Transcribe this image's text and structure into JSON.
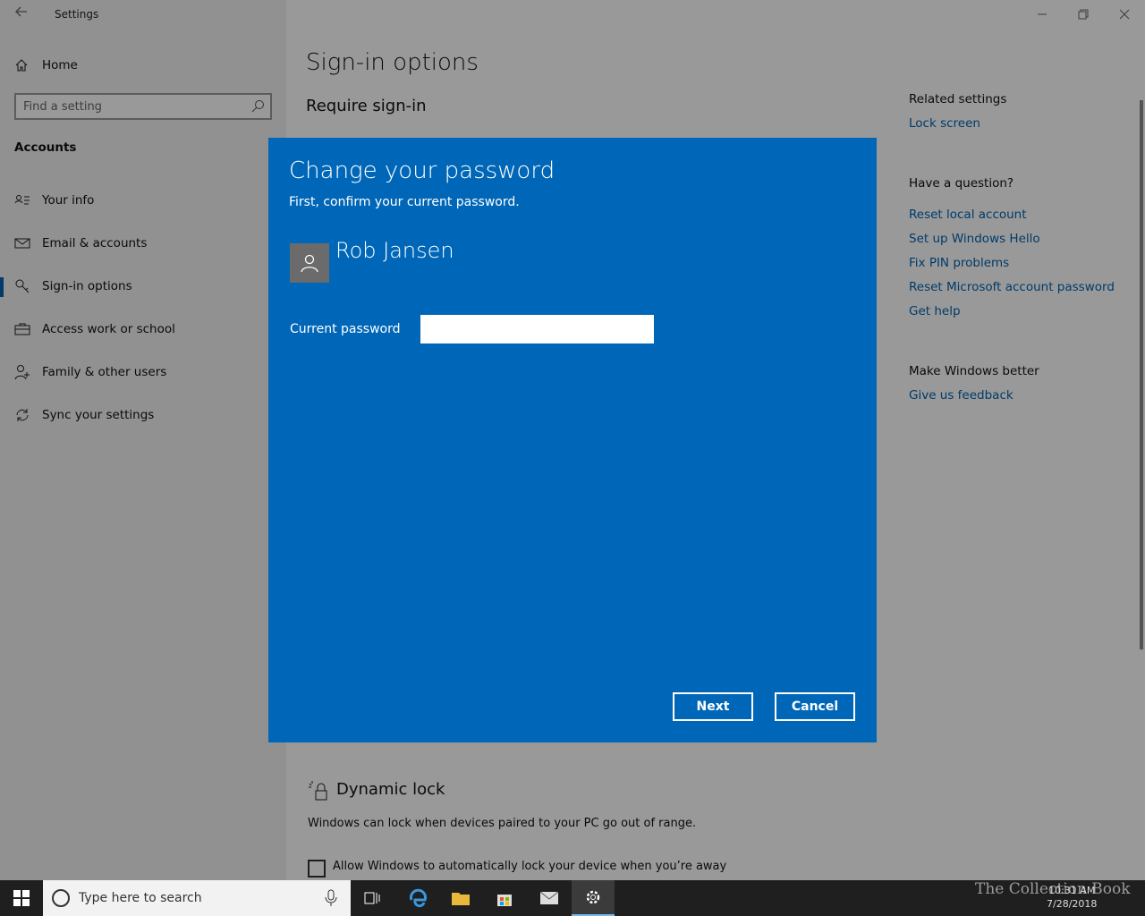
{
  "window": {
    "title": "Settings",
    "back_icon": "back-arrow-icon",
    "controls": [
      "minimize-icon",
      "restore-icon",
      "close-icon"
    ]
  },
  "sidebar": {
    "home_label": "Home",
    "search_placeholder": "Find a setting",
    "section": "Accounts",
    "items": [
      {
        "label": "Your info",
        "icon": "contact-card-icon"
      },
      {
        "label": "Email & accounts",
        "icon": "mail-icon"
      },
      {
        "label": "Sign-in options",
        "icon": "key-icon",
        "active": true
      },
      {
        "label": "Access work or school",
        "icon": "briefcase-icon"
      },
      {
        "label": "Family & other users",
        "icon": "person-add-icon"
      },
      {
        "label": "Sync your settings",
        "icon": "sync-icon"
      }
    ]
  },
  "main": {
    "title": "Sign-in options",
    "subtitle": "Require sign-in",
    "dynamic_lock": {
      "title": "Dynamic lock",
      "description": "Windows can lock when devices paired to your PC go out of range.",
      "checkbox_label": "Allow Windows to automatically lock your device when you’re away"
    }
  },
  "related": {
    "heading1": "Related settings",
    "link_lock_screen": "Lock screen",
    "heading2": "Have a question?",
    "links": [
      "Reset local account",
      "Set up Windows Hello",
      "Fix PIN problems",
      "Reset Microsoft account password",
      "Get help"
    ],
    "heading3": "Make Windows better",
    "feedback": "Give us feedback"
  },
  "dialog": {
    "title": "Change your password",
    "subtitle": "First, confirm your current password.",
    "user_name": "Rob Jansen",
    "password_label": "Current password",
    "password_value": "",
    "next_label": "Next",
    "cancel_label": "Cancel"
  },
  "taskbar": {
    "search_text": "Type here to search",
    "time": "10:31 AM",
    "date": "7/28/2018",
    "watermark": "The Collection Book",
    "accent": "#0067b8"
  }
}
